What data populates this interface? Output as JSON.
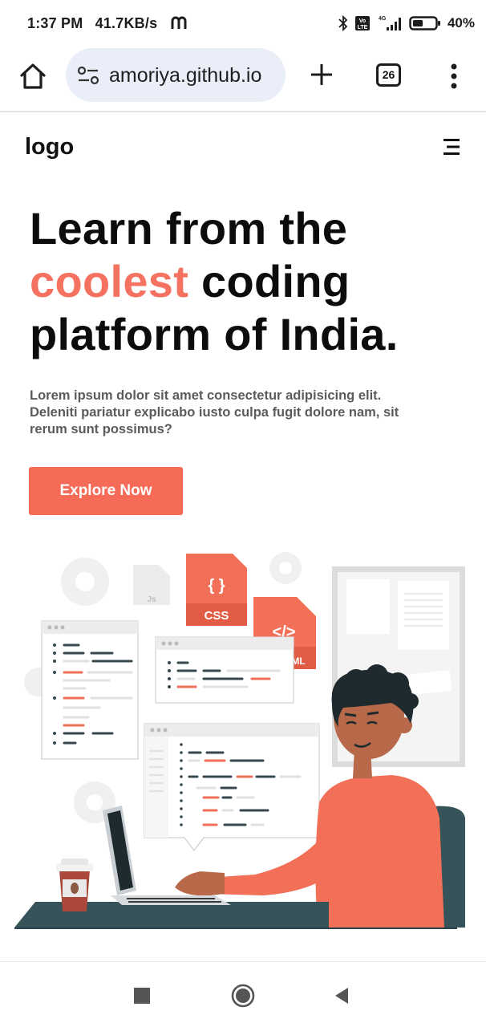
{
  "status_bar": {
    "time": "1:37 PM",
    "network_speed": "41.7KB/s",
    "carrier_icon": "m-logo-icon",
    "network_type": "4G",
    "volte": "Vo LTE",
    "battery": "40%"
  },
  "browser": {
    "url": "amoriya.github.io",
    "tab_count": "26",
    "icons": [
      "home-icon",
      "site-settings-icon",
      "new-tab-icon",
      "tab-switcher-icon",
      "more-menu-icon"
    ]
  },
  "page": {
    "logo": "logo",
    "hero": {
      "title_line1": "Learn from the",
      "title_accent": "coolest",
      "title_line2_rest": " coding",
      "title_line3": "platform of India.",
      "description": "Lorem ipsum dolor sit amet consectetur adipisicing elit. Deleniti pariatur explicabo iusto culpa fugit dolore nam, sit rerum sunt possimus?",
      "cta_label": "Explore Now"
    },
    "illustration": {
      "css_label": "CSS",
      "css_braces": "{ }",
      "html_tag": "</>",
      "html_partial": "ML",
      "js_label": "Js"
    }
  },
  "colors": {
    "accent": "#f57160",
    "cta": "#f56b58",
    "desk": "#37535a",
    "shirt": "#f26f58",
    "skin": "#b8694a",
    "hair": "#1f2a2e"
  }
}
